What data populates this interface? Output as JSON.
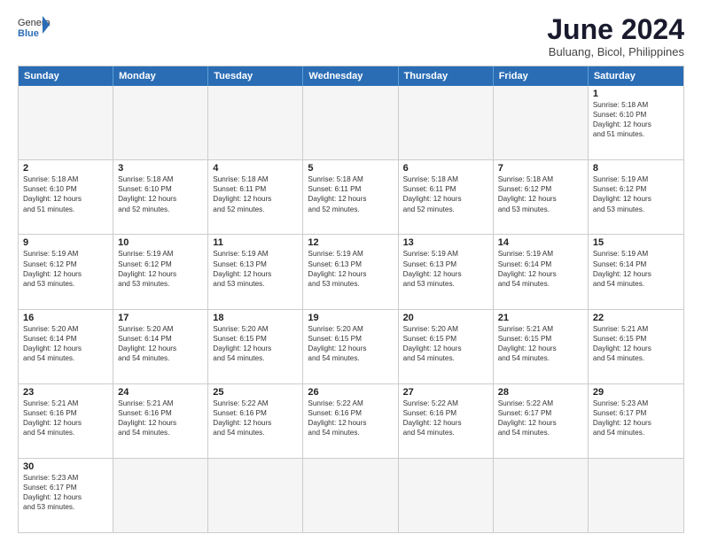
{
  "header": {
    "logo_general": "General",
    "logo_blue": "Blue",
    "month_title": "June 2024",
    "location": "Buluang, Bicol, Philippines"
  },
  "days_of_week": [
    "Sunday",
    "Monday",
    "Tuesday",
    "Wednesday",
    "Thursday",
    "Friday",
    "Saturday"
  ],
  "weeks": [
    [
      {
        "day": "",
        "empty": true
      },
      {
        "day": "",
        "empty": true
      },
      {
        "day": "",
        "empty": true
      },
      {
        "day": "",
        "empty": true
      },
      {
        "day": "",
        "empty": true
      },
      {
        "day": "",
        "empty": true
      },
      {
        "day": "1",
        "sunrise": "5:18 AM",
        "sunset": "6:10 PM",
        "daylight_h": "12",
        "daylight_m": "51"
      }
    ],
    [
      {
        "day": "2",
        "sunrise": "5:18 AM",
        "sunset": "6:10 PM",
        "daylight_h": "12",
        "daylight_m": "51"
      },
      {
        "day": "3",
        "sunrise": "5:18 AM",
        "sunset": "6:10 PM",
        "daylight_h": "12",
        "daylight_m": "52"
      },
      {
        "day": "4",
        "sunrise": "5:18 AM",
        "sunset": "6:11 PM",
        "daylight_h": "12",
        "daylight_m": "52"
      },
      {
        "day": "5",
        "sunrise": "5:18 AM",
        "sunset": "6:11 PM",
        "daylight_h": "12",
        "daylight_m": "52"
      },
      {
        "day": "6",
        "sunrise": "5:18 AM",
        "sunset": "6:11 PM",
        "daylight_h": "12",
        "daylight_m": "52"
      },
      {
        "day": "7",
        "sunrise": "5:18 AM",
        "sunset": "6:12 PM",
        "daylight_h": "12",
        "daylight_m": "53"
      },
      {
        "day": "8",
        "sunrise": "5:19 AM",
        "sunset": "6:12 PM",
        "daylight_h": "12",
        "daylight_m": "53"
      }
    ],
    [
      {
        "day": "9",
        "sunrise": "5:19 AM",
        "sunset": "6:12 PM",
        "daylight_h": "12",
        "daylight_m": "53"
      },
      {
        "day": "10",
        "sunrise": "5:19 AM",
        "sunset": "6:12 PM",
        "daylight_h": "12",
        "daylight_m": "53"
      },
      {
        "day": "11",
        "sunrise": "5:19 AM",
        "sunset": "6:13 PM",
        "daylight_h": "12",
        "daylight_m": "53"
      },
      {
        "day": "12",
        "sunrise": "5:19 AM",
        "sunset": "6:13 PM",
        "daylight_h": "12",
        "daylight_m": "53"
      },
      {
        "day": "13",
        "sunrise": "5:19 AM",
        "sunset": "6:13 PM",
        "daylight_h": "12",
        "daylight_m": "53"
      },
      {
        "day": "14",
        "sunrise": "5:19 AM",
        "sunset": "6:14 PM",
        "daylight_h": "12",
        "daylight_m": "54"
      },
      {
        "day": "15",
        "sunrise": "5:19 AM",
        "sunset": "6:14 PM",
        "daylight_h": "12",
        "daylight_m": "54"
      }
    ],
    [
      {
        "day": "16",
        "sunrise": "5:20 AM",
        "sunset": "6:14 PM",
        "daylight_h": "12",
        "daylight_m": "54"
      },
      {
        "day": "17",
        "sunrise": "5:20 AM",
        "sunset": "6:14 PM",
        "daylight_h": "12",
        "daylight_m": "54"
      },
      {
        "day": "18",
        "sunrise": "5:20 AM",
        "sunset": "6:15 PM",
        "daylight_h": "12",
        "daylight_m": "54"
      },
      {
        "day": "19",
        "sunrise": "5:20 AM",
        "sunset": "6:15 PM",
        "daylight_h": "12",
        "daylight_m": "54"
      },
      {
        "day": "20",
        "sunrise": "5:20 AM",
        "sunset": "6:15 PM",
        "daylight_h": "12",
        "daylight_m": "54"
      },
      {
        "day": "21",
        "sunrise": "5:21 AM",
        "sunset": "6:15 PM",
        "daylight_h": "12",
        "daylight_m": "54"
      },
      {
        "day": "22",
        "sunrise": "5:21 AM",
        "sunset": "6:15 PM",
        "daylight_h": "12",
        "daylight_m": "54"
      }
    ],
    [
      {
        "day": "23",
        "sunrise": "5:21 AM",
        "sunset": "6:16 PM",
        "daylight_h": "12",
        "daylight_m": "54"
      },
      {
        "day": "24",
        "sunrise": "5:21 AM",
        "sunset": "6:16 PM",
        "daylight_h": "12",
        "daylight_m": "54"
      },
      {
        "day": "25",
        "sunrise": "5:22 AM",
        "sunset": "6:16 PM",
        "daylight_h": "12",
        "daylight_m": "54"
      },
      {
        "day": "26",
        "sunrise": "5:22 AM",
        "sunset": "6:16 PM",
        "daylight_h": "12",
        "daylight_m": "54"
      },
      {
        "day": "27",
        "sunrise": "5:22 AM",
        "sunset": "6:16 PM",
        "daylight_h": "12",
        "daylight_m": "54"
      },
      {
        "day": "28",
        "sunrise": "5:22 AM",
        "sunset": "6:17 PM",
        "daylight_h": "12",
        "daylight_m": "54"
      },
      {
        "day": "29",
        "sunrise": "5:23 AM",
        "sunset": "6:17 PM",
        "daylight_h": "12",
        "daylight_m": "54"
      }
    ],
    [
      {
        "day": "30",
        "sunrise": "5:23 AM",
        "sunset": "6:17 PM",
        "daylight_h": "12",
        "daylight_m": "53"
      },
      {
        "day": "",
        "empty": true
      },
      {
        "day": "",
        "empty": true
      },
      {
        "day": "",
        "empty": true
      },
      {
        "day": "",
        "empty": true
      },
      {
        "day": "",
        "empty": true
      },
      {
        "day": "",
        "empty": true
      }
    ]
  ]
}
